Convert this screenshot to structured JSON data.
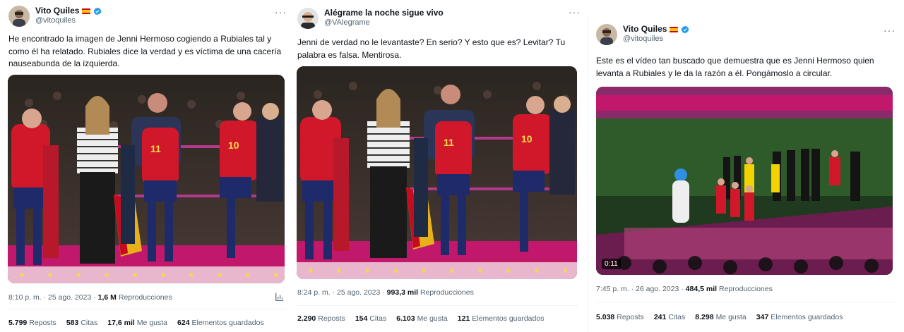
{
  "tweets": [
    {
      "display_name": "Vito Quiles",
      "handle": "@vitoquiles",
      "verified": true,
      "flag": "spain",
      "text": "He encontrado la imagen de Jenni Hermoso cogiendo a Rubiales tal y como él ha relatado. Rubiales dice la verdad y es víctima de una cacería nauseabunda de la izquierda.",
      "time": "8:10 p. m. · 25 ago. 2023 ·",
      "views_count": "1,6 M",
      "views_label": "Reproducciones",
      "reposts_count": "5.799",
      "reposts_label": "Reposts",
      "quotes_count": "583",
      "quotes_label": "Citas",
      "likes_count": "17,6 mil",
      "likes_label": "Me gusta",
      "bookmarks_count": "624",
      "bookmarks_label": "Elementos guardados"
    },
    {
      "display_name": "Alégrame la noche sigue vivo",
      "handle": "@VAlegrame",
      "verified": false,
      "text": "Jenni de verdad no le levantaste? En serio? Y esto que es? Levitar? Tu palabra es falsa. Mentirosa.",
      "time": "8:24 p. m. · 25 ago. 2023 ·",
      "views_count": "993,3 mil",
      "views_label": "Reproducciones",
      "reposts_count": "2.290",
      "reposts_label": "Reposts",
      "quotes_count": "154",
      "quotes_label": "Citas",
      "likes_count": "6.103",
      "likes_label": "Me gusta",
      "bookmarks_count": "121",
      "bookmarks_label": "Elementos guardados"
    },
    {
      "display_name": "Vito Quiles",
      "handle": "@vitoquiles",
      "verified": true,
      "flag": "spain",
      "text": "Este es el vídeo tan buscado que demuestra que es Jenni Hermoso quien levanta a Rubiales y le da la razón a él. Pongámoslo a circular.",
      "video_duration": "0:11",
      "time": "7:45 p. m. · 26 ago. 2023 ·",
      "views_count": "484,5 mil",
      "views_label": "Reproducciones",
      "reposts_count": "5.038",
      "reposts_label": "Reposts",
      "quotes_count": "241",
      "quotes_label": "Citas",
      "likes_count": "8.298",
      "likes_label": "Me gusta",
      "bookmarks_count": "347",
      "bookmarks_label": "Elementos guardados"
    }
  ],
  "colors": {
    "verified": "#1d9bf0",
    "text": "#0f1419",
    "muted": "#536471",
    "divider": "#eff3f4",
    "jersey_red": "#d1182b",
    "stage_pink": "#c2186b"
  }
}
